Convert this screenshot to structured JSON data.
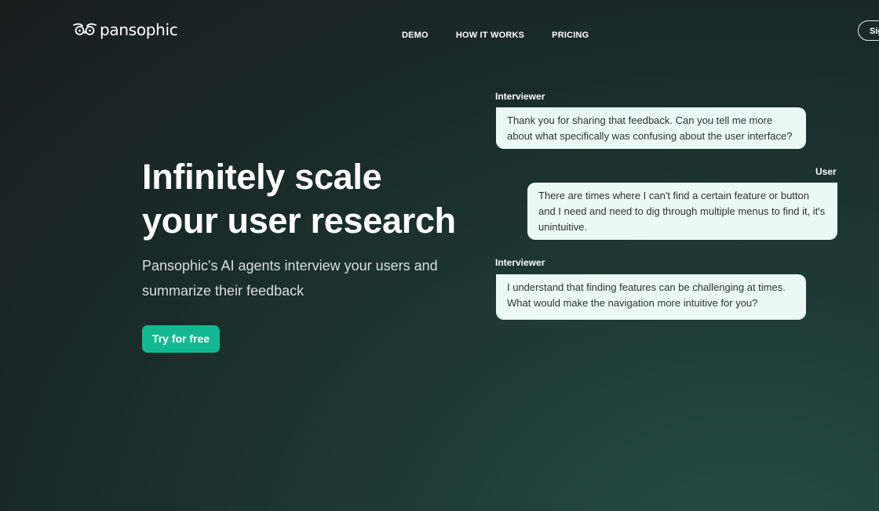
{
  "header": {
    "brand": "pansophic",
    "nav": [
      {
        "label": "DEMO"
      },
      {
        "label": "HOW IT WORKS"
      },
      {
        "label": "PRICING"
      }
    ],
    "signin_label": "Sign in"
  },
  "hero": {
    "title_line1": "Infinitely scale",
    "title_line2": "your user research",
    "subtitle": "Pansophic's AI agents interview your users and summarize their feedback",
    "cta_label": "Try for free"
  },
  "chat": {
    "messages": [
      {
        "role": "Interviewer",
        "text": "Thank you for sharing that feedback. Can you tell me more about what specifically was confusing about the user interface?"
      },
      {
        "role": "User",
        "text": "There are times where I can't find a certain feature or button and I need and need to dig through multiple menus to find it, it's unintuitive."
      },
      {
        "role": "Interviewer",
        "text": "I understand that finding features can be challenging at times. What would make the navigation more intuitive for you?"
      }
    ]
  },
  "colors": {
    "accent": "#14b890",
    "bubble_bg": "#ebf9f4",
    "background": "#1a2b28"
  }
}
